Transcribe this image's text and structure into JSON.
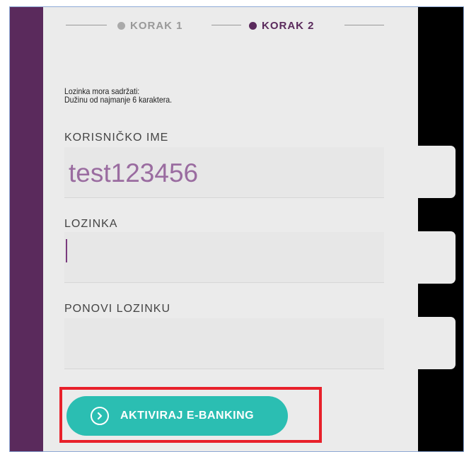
{
  "steps": [
    {
      "label": "KORAK 1",
      "color": "#aaaaaa",
      "active": false
    },
    {
      "label": "KORAK 2",
      "color": "#5a2a5c",
      "active": true
    }
  ],
  "hint": {
    "line1": "Lozinka mora sadržati:",
    "line2": "Dužinu od najmanje 6 karaktera."
  },
  "form": {
    "username_label": "KORISNIČKO IME",
    "username_value": "test123456",
    "password_label": "LOZINKA",
    "password_value": "",
    "confirm_label": "PONOVI LOZINKU",
    "confirm_value": ""
  },
  "button": {
    "label": "AKTIVIRAJ E-BANKING",
    "icon": "chevron-right-circle-icon",
    "color": "#2bbeb2"
  },
  "colors": {
    "brand_purple": "#5a2a5c",
    "highlight": "#e8202a"
  }
}
